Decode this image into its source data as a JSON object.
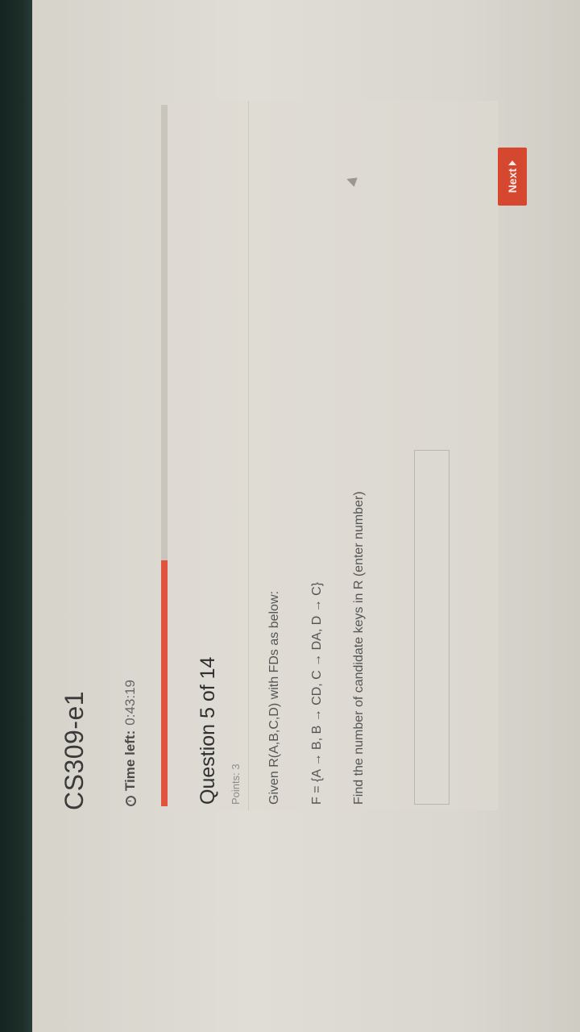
{
  "app": {
    "title": "CS309-e1"
  },
  "timer": {
    "label": "Time left:",
    "value": "0:43:19"
  },
  "progress": {
    "fraction": 0.35
  },
  "question": {
    "title": "Question 5 of 14",
    "points": "Points: 3",
    "lines": [
      "Given R(A,B,C,D) with FDs as below:",
      "F = {A → B, B → CD, C → DA, D → C}",
      "Find the number of candidate keys in R (enter number)"
    ]
  },
  "answer": {
    "value": ""
  },
  "navigation": {
    "next_label": "Next"
  },
  "colors": {
    "accent": "#e0533f",
    "next_button": "#d6472f"
  },
  "icons": {
    "timer": "clock-icon",
    "next": "next-arrow-icon"
  }
}
